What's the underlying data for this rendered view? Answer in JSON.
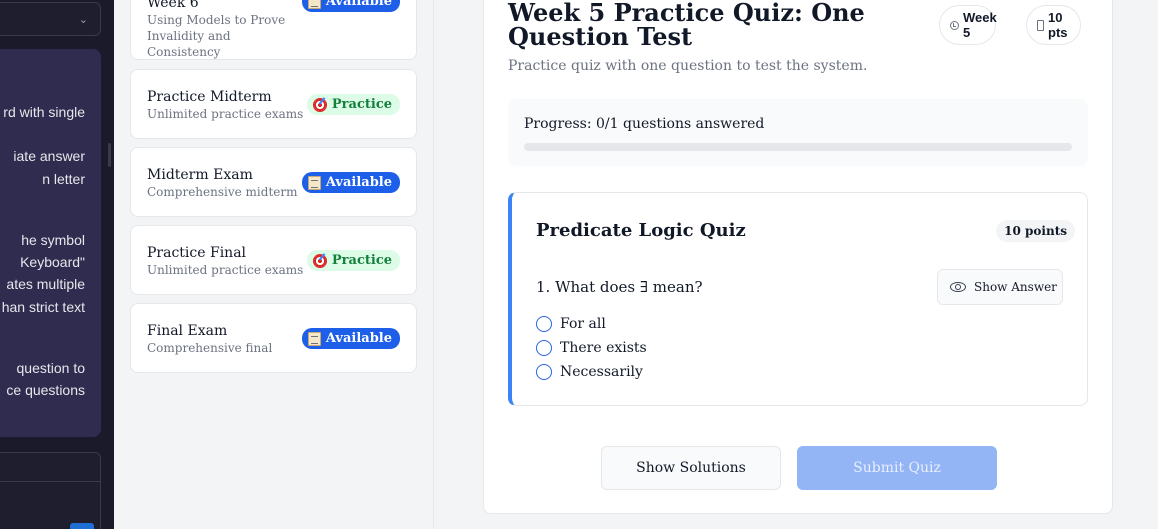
{
  "instructions_lines": [
    "rd with single",
    "iate answer",
    "n letter",
    "he symbol",
    "Keyboard\"",
    "ates multiple",
    "han strict text",
    "question to",
    "ce questions"
  ],
  "cards": [
    {
      "title": "Week 6",
      "subtitle": "Using Models to Prove Invalidity and Consistency",
      "badge": "Available",
      "badge_type": "available"
    },
    {
      "title": "Practice Midterm",
      "subtitle": "Unlimited practice exams",
      "badge": "Practice",
      "badge_type": "practice"
    },
    {
      "title": "Midterm Exam",
      "subtitle": "Comprehensive midterm",
      "badge": "Available",
      "badge_type": "available"
    },
    {
      "title": "Practice Final",
      "subtitle": "Unlimited practice exams",
      "badge": "Practice",
      "badge_type": "practice"
    },
    {
      "title": "Final Exam",
      "subtitle": "Comprehensive final",
      "badge": "Available",
      "badge_type": "available"
    }
  ],
  "quiz": {
    "title": "Week 5 Practice Quiz: One Question Test",
    "description": "Practice quiz with one question to test the system.",
    "week_pill": "Week 5",
    "points_pill": "10 pts",
    "progress_label": "Progress: 0/1 questions answered",
    "progress_fraction": 0,
    "section_title": "Predicate Logic Quiz",
    "section_points": "10 points",
    "question": "1. What does ∃ mean?",
    "show_answer": "Show Answer",
    "options": [
      "For all",
      "There exists",
      "Necessarily"
    ],
    "show_solutions": "Show Solutions",
    "submit": "Submit Quiz"
  },
  "colors": {
    "accent": "#2563eb",
    "available": "#1d5fe8",
    "practice_bg": "#dcfce7",
    "practice_text": "#15803d",
    "sidebar_dark": "#1a1a2a",
    "instructions_bg": "#2f2c4f"
  }
}
